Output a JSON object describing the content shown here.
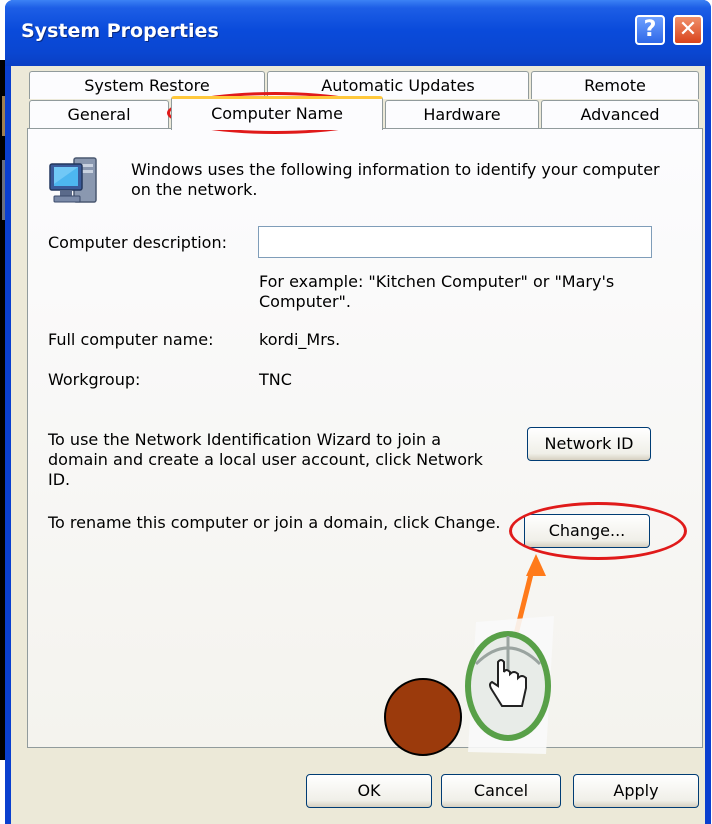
{
  "window": {
    "title": "System Properties",
    "help_glyph": "?",
    "close_glyph": "✕"
  },
  "tabs": {
    "row1": [
      "System Restore",
      "Automatic Updates",
      "Remote"
    ],
    "row2": [
      "General",
      "Computer Name",
      "Hardware",
      "Advanced"
    ],
    "selected": "Computer Name"
  },
  "panel": {
    "intro": "Windows uses the following information to identify your computer on the network.",
    "description_label": "Computer description:",
    "description_value": "",
    "example": "For example: \"Kitchen Computer\" or \"Mary's Computer\".",
    "full_name_label": "Full computer name:",
    "full_name_value": "kordi_Mrs.",
    "workgroup_label": "Workgroup:",
    "workgroup_value": "TNC",
    "wizard_text": "To use the Network Identification Wizard to join a domain and create a local user account, click Network ID.",
    "network_id_button": "Network ID",
    "rename_text": "To rename this computer or join a domain, click Change.",
    "change_button": "Change..."
  },
  "footer": {
    "ok": "OK",
    "cancel": "Cancel",
    "apply": "Apply"
  },
  "colors": {
    "highlight": "#e01a1a",
    "arrow": "#ff7a1a",
    "dot": "#9b3a0c"
  },
  "icons": [
    "computer-icon",
    "mouse-pointer-icon"
  ]
}
